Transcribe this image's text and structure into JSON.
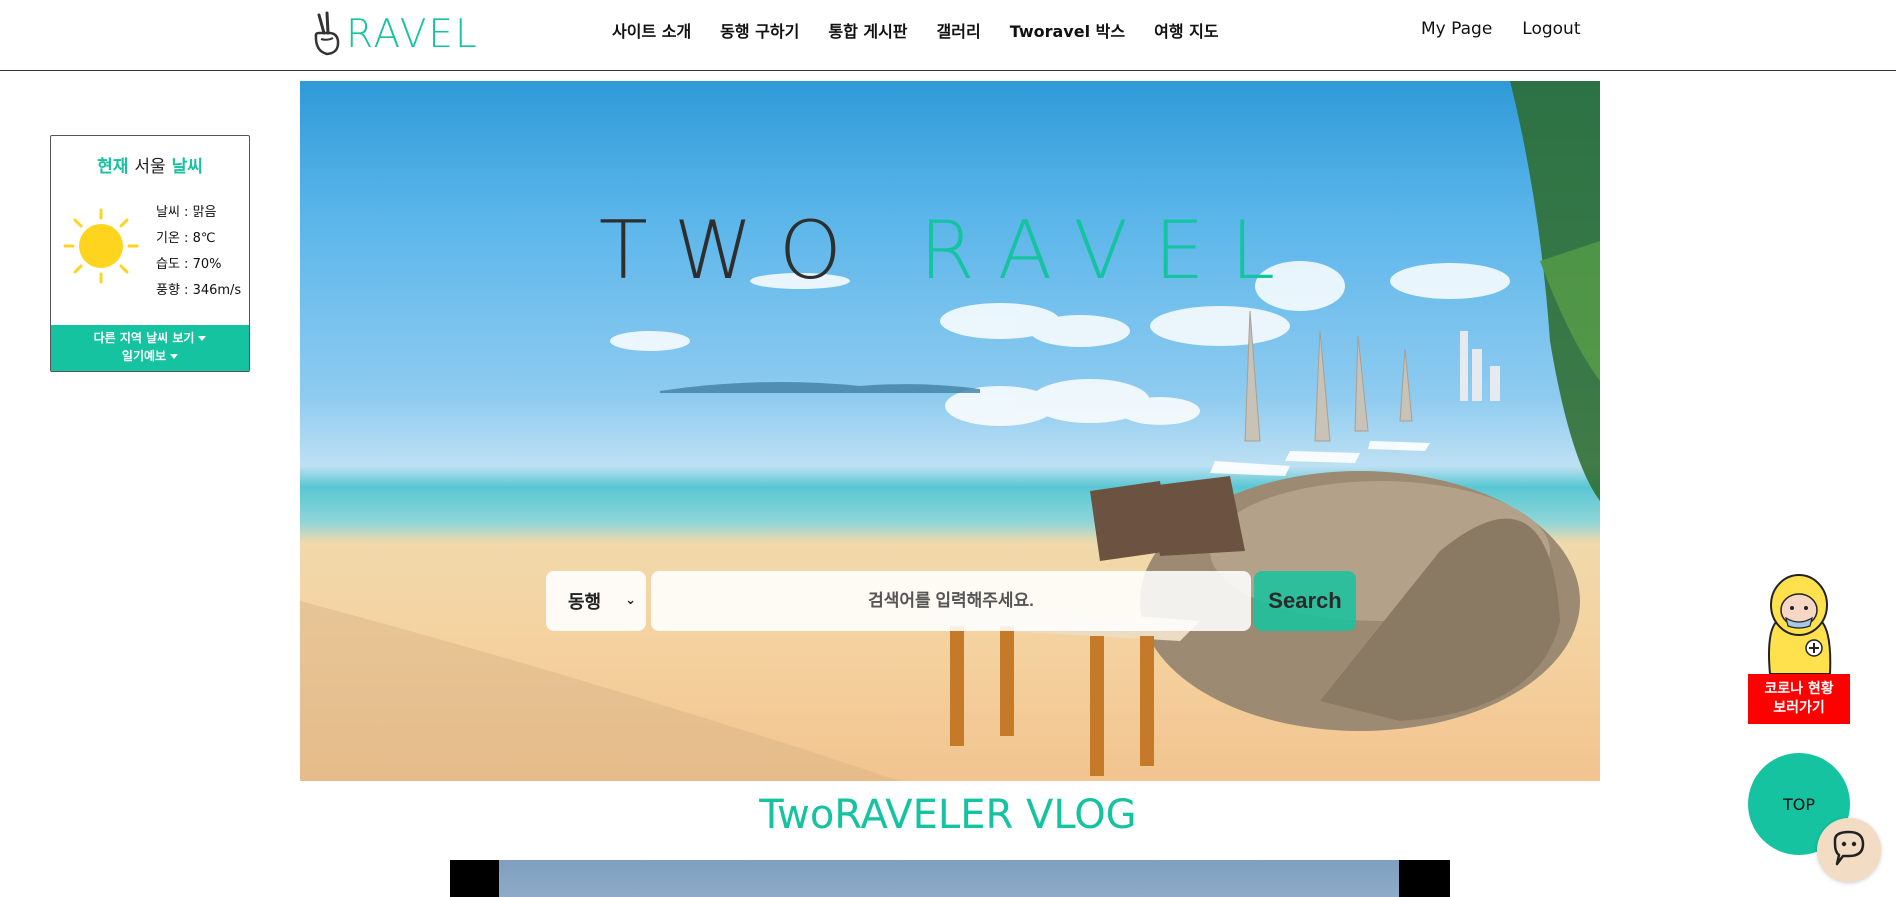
{
  "header": {
    "logo_text": "RAVEL",
    "nav": [
      "사이트 소개",
      "동행 구하기",
      "통합 게시판",
      "갤러리",
      "Tworavel 박스",
      "여행 지도"
    ],
    "account": [
      "My Page",
      "Logout"
    ]
  },
  "weather": {
    "title_part1": "현재",
    "title_city": "서울",
    "title_part2": "날씨",
    "lines": [
      "날씨 : 맑음",
      "기온 : 8℃",
      "습도 : 70%",
      "풍향 : 346m/s"
    ],
    "button_other": "다른 지역 날씨 보기",
    "button_forecast": "일기예보",
    "icon": "sun-icon"
  },
  "hero": {
    "title_dark": "TWO",
    "title_accent": "RAVEL",
    "select_value": "동행",
    "search_placeholder": "검색어를 입력해주세요.",
    "search_button": "Search"
  },
  "vlog": {
    "title": "TwoRAVELER VLOG"
  },
  "side": {
    "covid_label_1": "코로나 현황",
    "covid_label_2": "보러가기",
    "top_label": "TOP"
  },
  "colors": {
    "accent": "#16c3a0",
    "covid_red": "#ff0000"
  }
}
